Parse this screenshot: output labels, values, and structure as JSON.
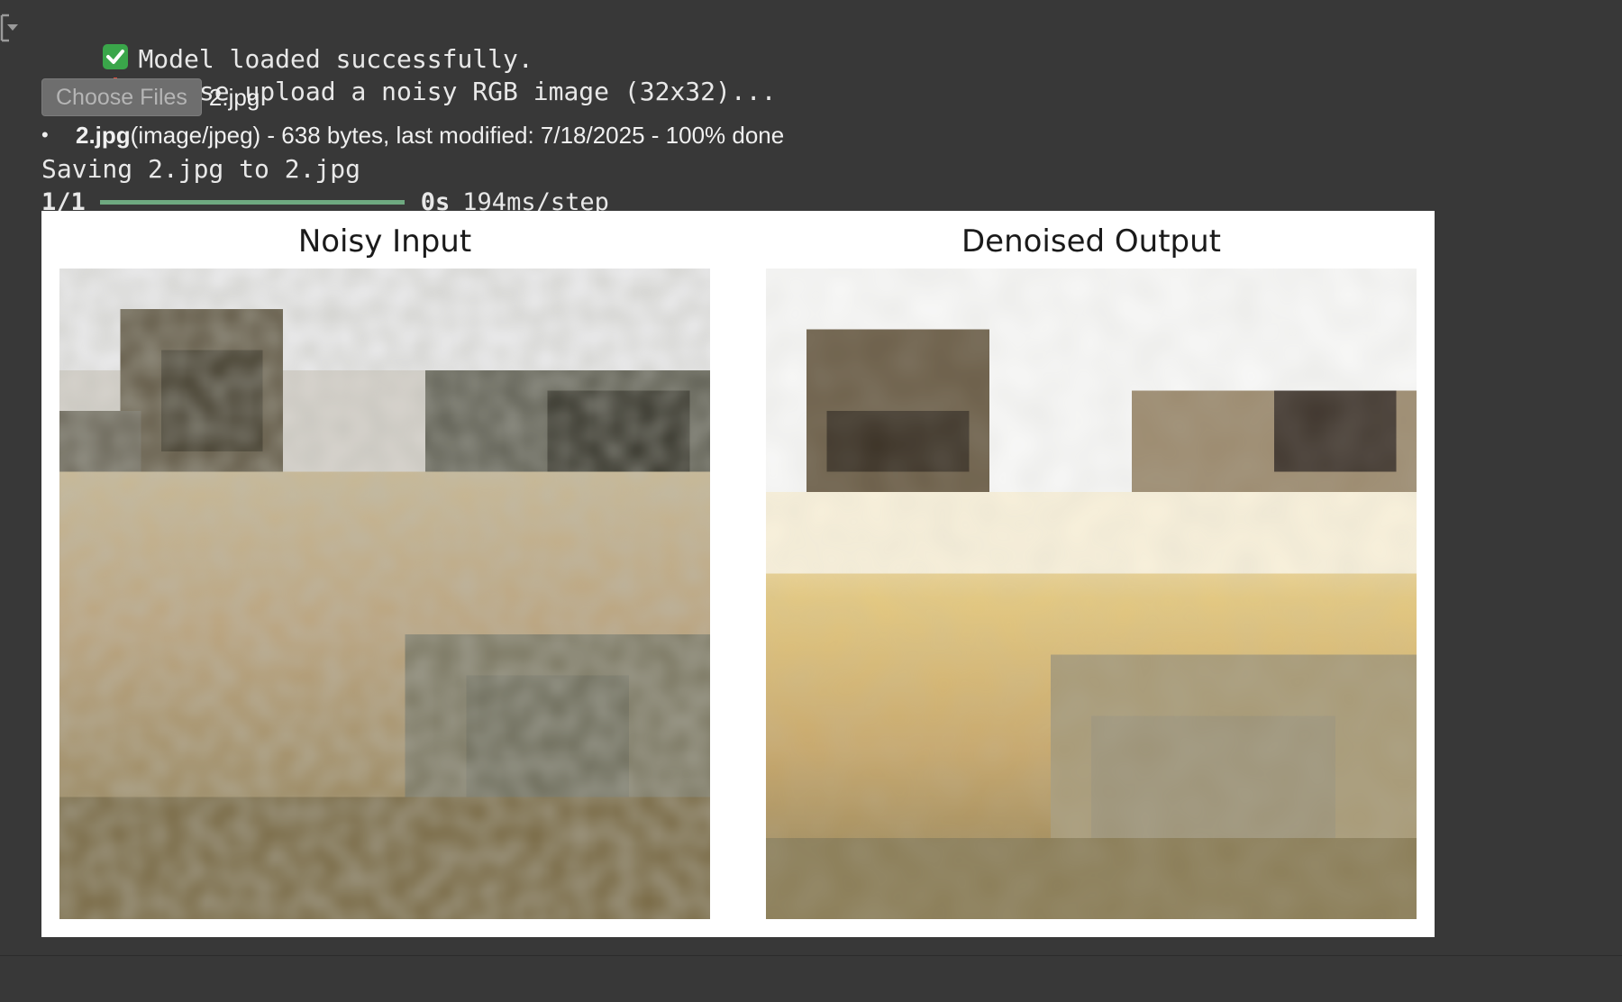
{
  "output": {
    "line1": {
      "icon": "check-mark-icon",
      "text": "Model loaded successfully."
    },
    "line2": {
      "icon": "inbox-tray-icon",
      "text": "Please upload a noisy RGB image (32x32)..."
    },
    "upload": {
      "button_label": "Choose Files",
      "selected_file": "2.jpg"
    },
    "file_info": {
      "name": "2.jpg",
      "details": "(image/jpeg) - 638 bytes, last modified: 7/18/2025 - 100% done"
    },
    "saving_text": "Saving 2.jpg to 2.jpg",
    "progress": {
      "steps": "1/1",
      "fraction": 1.0,
      "eta": "0s",
      "rate": "194ms/step",
      "bar_color": "#6ea980"
    }
  },
  "figure": {
    "panels": [
      {
        "title": "Noisy Input"
      },
      {
        "title": "Denoised Output"
      }
    ]
  },
  "colors": {
    "background": "#383838",
    "figure_bg": "#ffffff",
    "check_green": "#3aa64a"
  }
}
